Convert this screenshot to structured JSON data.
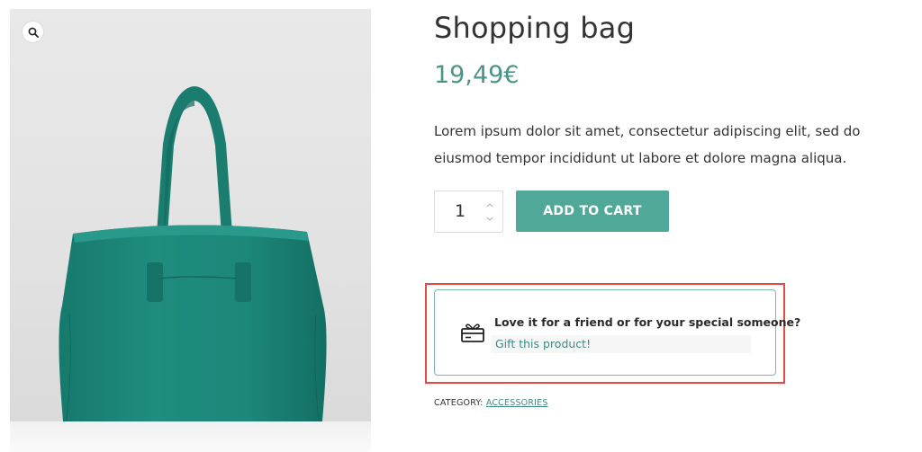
{
  "product": {
    "title": "Shopping bag",
    "price": "19,49€",
    "description": "Lorem ipsum dolor sit amet, consectetur adipiscing elit, sed do eiusmod tempor incididunt ut labore et dolore magna aliqua.",
    "image_icon": "zoom-magnifier-icon"
  },
  "cart": {
    "quantity": "1",
    "add_to_cart_label": "ADD TO CART"
  },
  "gift": {
    "heading": "Love it for a friend or for your special someone?",
    "link_label": "Gift this product!",
    "icon": "gift-card-icon"
  },
  "meta": {
    "category_label": "CATEGORY:",
    "category_value": "ACCESSORIES"
  },
  "colors": {
    "accent": "#4fa898",
    "price": "#4b9488",
    "bag": "#1f8a7c",
    "highlight_border": "#e04b43"
  }
}
